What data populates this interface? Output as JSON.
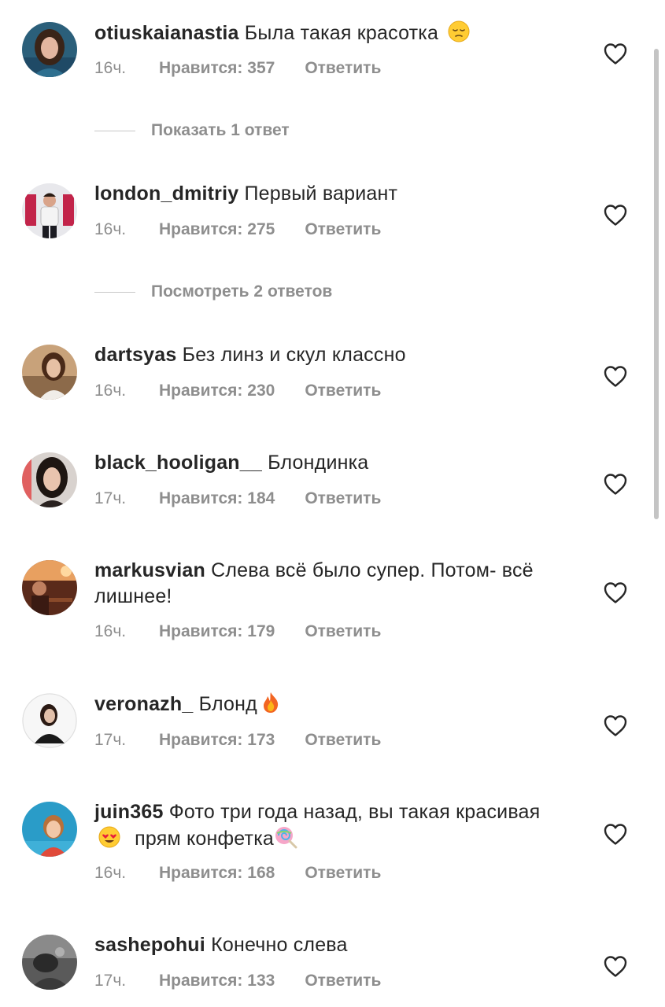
{
  "comments": [
    {
      "username": "otiuskaianastia",
      "text": "Была такая красотка",
      "emoji": "pensive-face-emoji",
      "time": "16ч.",
      "likes": "Нравится: 357",
      "reply": "Ответить",
      "replies_toggle": "Показать 1 ответ"
    },
    {
      "username": "london_dmitriy",
      "text": "Первый вариант",
      "time": "16ч.",
      "likes": "Нравится: 275",
      "reply": "Ответить",
      "replies_toggle": "Посмотреть 2 ответов"
    },
    {
      "username": "dartsyas",
      "text": "Без линз и скул классно",
      "time": "16ч.",
      "likes": "Нравится: 230",
      "reply": "Ответить"
    },
    {
      "username": "black_hooligan__",
      "text": "Блондинка",
      "time": "17ч.",
      "likes": "Нравится: 184",
      "reply": "Ответить"
    },
    {
      "username": "markusvian",
      "text": "Слева всё было супер. Потом- всё лишнее!",
      "time": "16ч.",
      "likes": "Нравится: 179",
      "reply": "Ответить"
    },
    {
      "username": "veronazh_",
      "text": "Блонд",
      "emoji": "fire-emoji",
      "time": "17ч.",
      "likes": "Нравится: 173",
      "reply": "Ответить"
    },
    {
      "username": "juin365",
      "text_part1": "Фото три года назад, вы такая красивая",
      "emoji1": "heart-eyes-emoji",
      "text_part2": "прям конфетка",
      "emoji2": "lollipop-emoji",
      "time": "16ч.",
      "likes": "Нравится: 168",
      "reply": "Ответить"
    },
    {
      "username": "sashepohui",
      "text": "Конечно слева",
      "time": "17ч.",
      "likes": "Нравится: 133",
      "reply": "Ответить"
    }
  ],
  "icons": {
    "like": "heart-outline-icon"
  },
  "colors": {
    "text": "#262626",
    "secondary": "#8e8e8e",
    "divider": "#c7c7c7"
  }
}
